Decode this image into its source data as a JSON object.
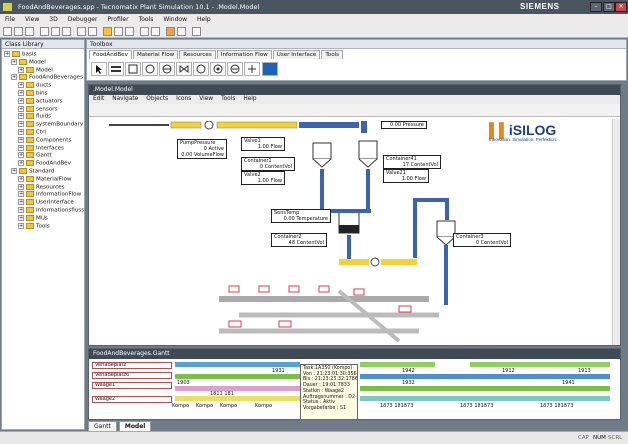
{
  "window": {
    "title": "FoodAndBeverages.spp - Tecnomatix Plant Simulation 10.1 - .Model.Model",
    "brand": "SIEMENS"
  },
  "menu": [
    "File",
    "View",
    "3D",
    "Debugger",
    "Profiler",
    "Tools",
    "Window",
    "Help"
  ],
  "class_library": {
    "title": "Class Library",
    "items": [
      {
        "label": "basis",
        "level": 0
      },
      {
        "label": "Model",
        "level": 1
      },
      {
        "label": "Model",
        "level": 2
      },
      {
        "label": "FoodAndBeverages",
        "level": 1
      },
      {
        "label": "ducts",
        "level": 2
      },
      {
        "label": "bins",
        "level": 2
      },
      {
        "label": "actuators",
        "level": 2
      },
      {
        "label": "sensors",
        "level": 2
      },
      {
        "label": "fluids",
        "level": 2
      },
      {
        "label": "systemBoundary",
        "level": 2
      },
      {
        "label": "Ctrl",
        "level": 2
      },
      {
        "label": "Components",
        "level": 2
      },
      {
        "label": "Interfaces",
        "level": 2
      },
      {
        "label": "Gantt",
        "level": 2
      },
      {
        "label": "FoodAndBev",
        "level": 2
      },
      {
        "label": "Standard",
        "level": 1
      },
      {
        "label": "MaterialFlow",
        "level": 2
      },
      {
        "label": "Resources",
        "level": 2
      },
      {
        "label": "InformationFlow",
        "level": 2
      },
      {
        "label": "UserInterface",
        "level": 2
      },
      {
        "label": "Informationsfluss",
        "level": 2
      },
      {
        "label": "MUs",
        "level": 2
      },
      {
        "label": "Tools",
        "level": 2
      }
    ]
  },
  "toolbox": {
    "title": "Toolbox",
    "tabs": [
      "FoodAndBev",
      "Material Flow",
      "Resources",
      "Information Flow",
      "User Interface",
      "Tools"
    ]
  },
  "model_window": {
    "title": ".Model.Model",
    "menu": [
      "Edit",
      "Navigate",
      "Objects",
      "Icons",
      "View",
      "Tools",
      "Help"
    ]
  },
  "model_boxes": {
    "pump": {
      "name": "PumpPressure",
      "l1": "0  Active",
      "l2": "0.00  VolumeFlow"
    },
    "valve1": {
      "name": "Valve1",
      "l1": "1.00  Flow"
    },
    "container1": {
      "name": "Container1",
      "l1": "0  ContentVol"
    },
    "valve2": {
      "name": "Valve2",
      "l1": "1.00  Flow"
    },
    "container41": {
      "name": "Container41",
      "l1": "17  ContentVol"
    },
    "valve21": {
      "name": "Valve21",
      "l1": "1.00  Flow"
    },
    "pressure": {
      "l1": "0.00  Pressure"
    },
    "sens": {
      "name": "SensTemp",
      "l1": "0.00  Temperature"
    },
    "container2": {
      "name": "Container2",
      "l1": "48  ContentVol"
    },
    "container3": {
      "name": "Container3",
      "l1": "0  ContentVol"
    }
  },
  "logo": {
    "name": "iSILOG",
    "tagline": "Innovation. Simulation. Perfektion."
  },
  "gantt": {
    "title": "FoodAndBeverages.Gantt",
    "rows": [
      "Verladeplatz",
      "Verladeplatz6",
      "Waage1",
      "Waage2"
    ],
    "labels": [
      "1931",
      "1942",
      "1912",
      "1913",
      "1903",
      "1932",
      "1941",
      "1811 181",
      "Kompo",
      "Kompo",
      "Kompo",
      "Kompo",
      "1873 181873",
      "1873 181873",
      "1873 181873"
    ],
    "tooltip": [
      "Task:1A350 (Kompo)",
      "Von : 21:23:01:30:3564",
      "Bis : 21:23:23:32:1786",
      "Dauer : 19:01:7833",
      "Station : Waage2",
      "Auftragsnummer : D2-23",
      "Status : Aktiv",
      "Vorgabefarbe : S1"
    ]
  },
  "bottom_tabs": [
    "Gantt",
    "Model"
  ],
  "status": [
    "CAP",
    "NUM",
    "SCRL"
  ]
}
